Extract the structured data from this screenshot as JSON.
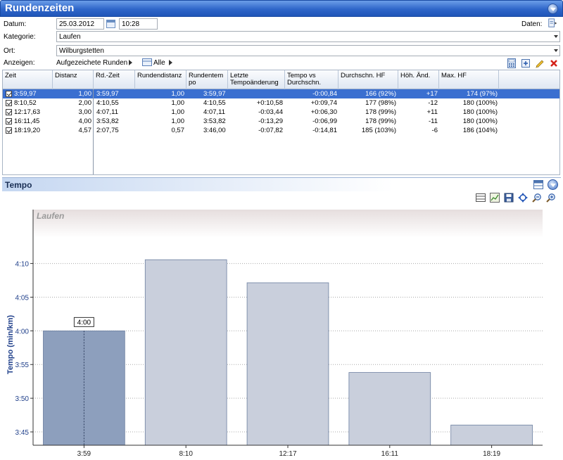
{
  "window": {
    "title": "Rundenzeiten"
  },
  "form": {
    "datum_label": "Datum:",
    "datum_value": "25.03.2012",
    "time_value": "10:28",
    "daten_label": "Daten:",
    "kategorie_label": "Kategorie:",
    "kategorie_value": "Laufen",
    "ort_label": "Ort:",
    "ort_value": "Wilburgstetten",
    "anzeigen_label": "Anzeigen:",
    "anzeigen_value": "Aufgezeichete Runden",
    "filter_value": "Alle"
  },
  "table": {
    "columns": [
      "Zeit",
      "Distanz",
      "Rd.-Zeit",
      "Rundendistanz",
      "Rundentem po",
      "Letzte Tempoänderung",
      "Tempo vs Durchschn.",
      "Durchschn. HF",
      "Höh. Änd.",
      "Max. HF"
    ],
    "rows": [
      {
        "zeit": "3:59,97",
        "distanz": "1,00",
        "rdzeit": "3:59,97",
        "rundendistanz": "1,00",
        "rundentempo": "3:59,97",
        "letzte": "",
        "tempovs": "-0:00,84",
        "hf": "166 (92%)",
        "hoeh": "+17",
        "maxhf": "174 (97%)",
        "selected": true
      },
      {
        "zeit": "8:10,52",
        "distanz": "2,00",
        "rdzeit": "4:10,55",
        "rundendistanz": "1,00",
        "rundentempo": "4:10,55",
        "letzte": "+0:10,58",
        "tempovs": "+0:09,74",
        "hf": "177 (98%)",
        "hoeh": "-12",
        "maxhf": "180 (100%)",
        "selected": false
      },
      {
        "zeit": "12:17,63",
        "distanz": "3,00",
        "rdzeit": "4:07,11",
        "rundendistanz": "1,00",
        "rundentempo": "4:07,11",
        "letzte": "-0:03,44",
        "tempovs": "+0:06,30",
        "hf": "178 (99%)",
        "hoeh": "+11",
        "maxhf": "180 (100%)",
        "selected": false
      },
      {
        "zeit": "16:11,45",
        "distanz": "4,00",
        "rdzeit": "3:53,82",
        "rundendistanz": "1,00",
        "rundentempo": "3:53,82",
        "letzte": "-0:13,29",
        "tempovs": "-0:06,99",
        "hf": "178 (99%)",
        "hoeh": "-11",
        "maxhf": "180 (100%)",
        "selected": false
      },
      {
        "zeit": "18:19,20",
        "distanz": "4,57",
        "rdzeit": "2:07,75",
        "rundendistanz": "0,57",
        "rundentempo": "3:46,00",
        "letzte": "-0:07,82",
        "tempovs": "-0:14,81",
        "hf": "185 (103%)",
        "hoeh": "-6",
        "maxhf": "186 (104%)",
        "selected": false
      }
    ]
  },
  "panel": {
    "title": "Tempo"
  },
  "chart_data": {
    "type": "bar",
    "title": "Laufen",
    "xlabel": "",
    "ylabel": "Tempo (min/km)",
    "categories": [
      "3:59",
      "8:10",
      "12:17",
      "16:11",
      "18:19"
    ],
    "values": [
      4.0,
      4.176,
      4.119,
      3.897,
      3.767
    ],
    "ylim": [
      3.717,
      4.3
    ],
    "yticks": [
      3.75,
      3.8333,
      3.9167,
      4.0,
      4.0833,
      4.1667
    ],
    "ytick_labels": [
      "3:45",
      "3:50",
      "3:55",
      "4:00",
      "4:05",
      "4:10"
    ],
    "highlight_index": 0,
    "highlight_label": "4:00",
    "colors": {
      "bar": "#c9cfdc",
      "bar_highlight": "#8d9fbd",
      "bar_edge": "#6c7fa0",
      "axis_text": "#1f3f8a"
    },
    "grid": true
  }
}
